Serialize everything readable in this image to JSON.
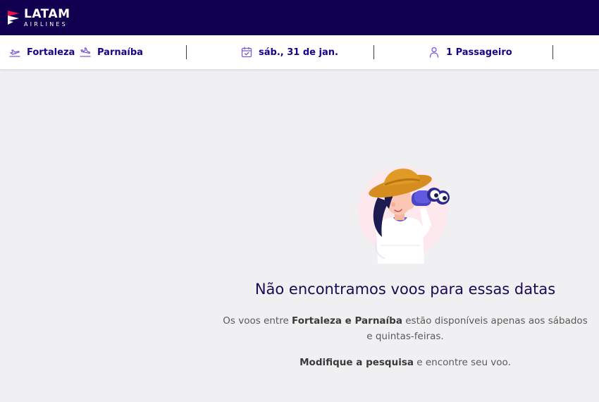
{
  "brand": {
    "name": "LATAM",
    "sub": "AIRLINES",
    "colors": {
      "primary": "#10004f",
      "accent": "#e8114b",
      "text_accent": "#1b0088"
    }
  },
  "search": {
    "origin": "Fortaleza",
    "destination": "Parnaíba",
    "date": "sáb., 31 de jan.",
    "passengers": "1 Passageiro",
    "icons": {
      "origin": "takeoff-icon",
      "destination": "landing-icon",
      "date": "calendar-icon",
      "passengers": "person-icon"
    }
  },
  "empty_state": {
    "title": "Não encontramos voos para essas datas",
    "desc_prefix": "Os voos entre ",
    "desc_route": "Fortaleza e Parnaíba",
    "desc_suffix": " estão disponíveis apenas aos sábados e quintas-feiras.",
    "modify_bold": "Modifique a pesquisa",
    "modify_rest": " e encontre seu voo.",
    "illustration": "woman-binoculars-illustration"
  }
}
